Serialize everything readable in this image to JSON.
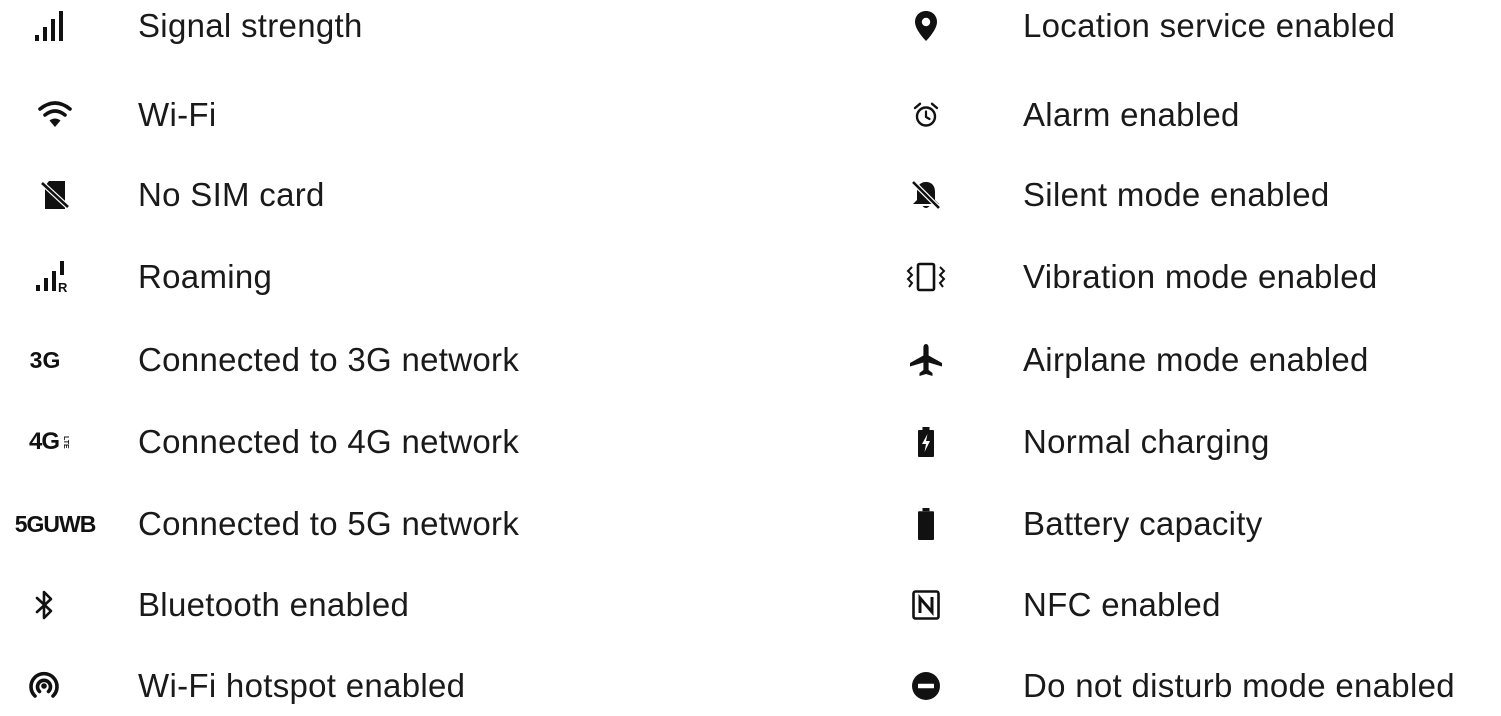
{
  "left": [
    {
      "icon": "signal-strength-icon",
      "label": "Signal strength"
    },
    {
      "icon": "wifi-icon",
      "label": "Wi-Fi"
    },
    {
      "icon": "no-sim-card-icon",
      "label": "No SIM card"
    },
    {
      "icon": "roaming-icon",
      "label": "Roaming"
    },
    {
      "icon": "3g-icon",
      "icon_text": "3G",
      "label": "Connected to 3G network"
    },
    {
      "icon": "4g-lte-icon",
      "icon_text": "4G",
      "icon_subtext": "LTE",
      "label": "Connected to 4G network"
    },
    {
      "icon": "5g-uwb-icon",
      "icon_text": "5GUWB",
      "label": "Connected to 5G network"
    },
    {
      "icon": "bluetooth-icon",
      "label": "Bluetooth enabled"
    },
    {
      "icon": "wifi-hotspot-icon",
      "label": "Wi-Fi hotspot enabled"
    }
  ],
  "right": [
    {
      "icon": "location-icon",
      "label": "Location service enabled"
    },
    {
      "icon": "alarm-icon",
      "label": "Alarm enabled"
    },
    {
      "icon": "silent-mode-icon",
      "label": "Silent mode enabled"
    },
    {
      "icon": "vibration-icon",
      "label": "Vibration mode enabled"
    },
    {
      "icon": "airplane-icon",
      "label": "Airplane mode enabled"
    },
    {
      "icon": "charging-icon",
      "label": "Normal charging"
    },
    {
      "icon": "battery-icon",
      "label": "Battery capacity"
    },
    {
      "icon": "nfc-icon",
      "label": "NFC enabled"
    },
    {
      "icon": "do-not-disturb-icon",
      "label": "Do not disturb mode enabled"
    }
  ],
  "colors": {
    "text": "#1a1a1a",
    "icon": "#111111",
    "background": "#ffffff"
  }
}
